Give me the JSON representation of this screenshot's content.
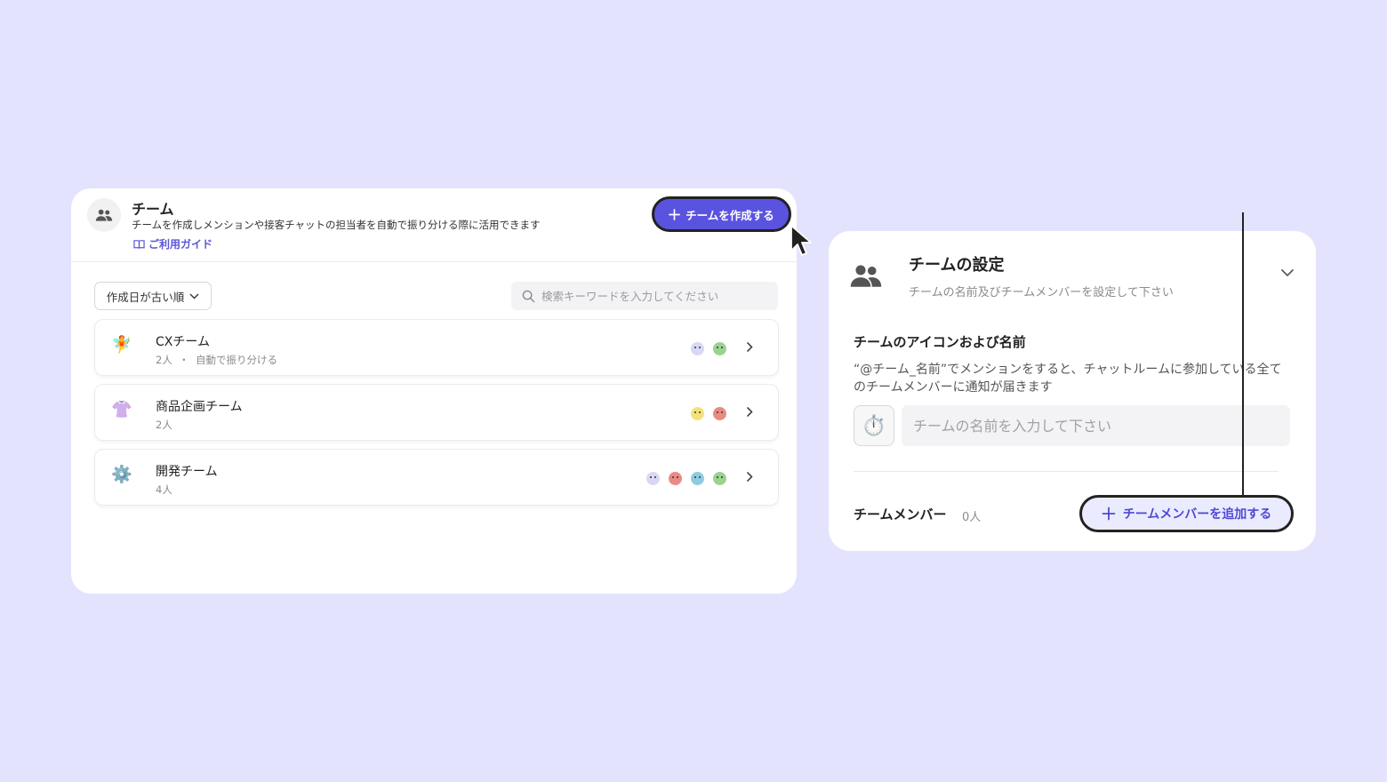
{
  "left_panel": {
    "title": "チーム",
    "description": "チームを作成しメンションや接客チャットの担当者を自動で振り分ける際に活用できます",
    "guide_link": "ご利用ガイド",
    "create_button": "チームを作成する",
    "sort_label": "作成日が古い順",
    "search_placeholder": "検索キーワードを入力してください",
    "teams": [
      {
        "name": "CXチーム",
        "members": "2人",
        "separator": "・",
        "mode": "自動で振り分ける",
        "icon": "🧚",
        "avatar_colors": [
          "#d8d8f4",
          "#9bd28f"
        ]
      },
      {
        "name": "商品企画チーム",
        "members": "2人",
        "icon": "👚",
        "avatar_colors": [
          "#f2e27a",
          "#e98a84"
        ]
      },
      {
        "name": "開発チーム",
        "members": "4人",
        "icon": "⚙️",
        "avatar_colors": [
          "#d8d8f4",
          "#e98a84",
          "#8fcbe0",
          "#9bd28f"
        ]
      }
    ]
  },
  "right_panel": {
    "title": "チームの設定",
    "subtitle": "チームの名前及びチームメンバーを設定して下さい",
    "section_title": "チームのアイコンおよび名前",
    "section_desc": "“@チーム_名前”でメンションをすると、チャットルームに参加している全てのチームメンバーに通知が届きます",
    "icon_emoji": "⏱️",
    "name_placeholder": "チームの名前を入力して下さい",
    "member_title": "チームメンバー",
    "member_count": "0人",
    "add_member_button": "チームメンバーを追加する"
  },
  "colors": {
    "background": "#e3e3fd",
    "accent": "#5a53e0",
    "accent_light": "#ebebff"
  }
}
